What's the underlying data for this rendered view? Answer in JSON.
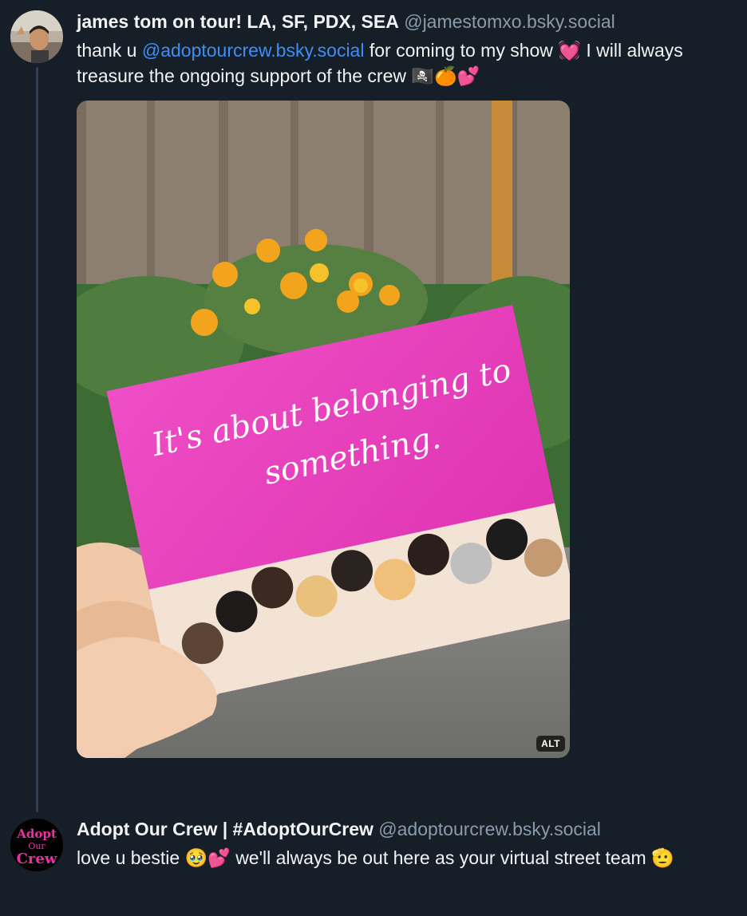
{
  "thread": {
    "post1": {
      "display_name": "james tom on tour! LA, SF, PDX, SEA",
      "handle": "@jamestomxo.bsky.social",
      "text_before": "thank u ",
      "mention": "@adoptourcrew.bsky.social",
      "text_after": " for coming to my show 💓 I will always treasure the ongoing support of the crew 🏴‍☠️🍊💕",
      "image": {
        "card_text_line1": "It's about belonging to",
        "card_text_line2": "something.",
        "alt_badge": "ALT"
      }
    },
    "post2": {
      "display_name": "Adopt Our Crew | #AdoptOurCrew",
      "handle": "@adoptourcrew.bsky.social",
      "text": "love u bestie 🥹💕 we'll always be out here as your virtual street team 🫡",
      "avatar_text": [
        "Adopt",
        "Our",
        "Crew"
      ]
    }
  },
  "colors": {
    "background": "#161e27",
    "text": "#f1f3f5",
    "handle": "#8a9bac",
    "link": "#3e8ef7",
    "thread_line": "#2e4052",
    "card_pink": "#e43ab9"
  }
}
